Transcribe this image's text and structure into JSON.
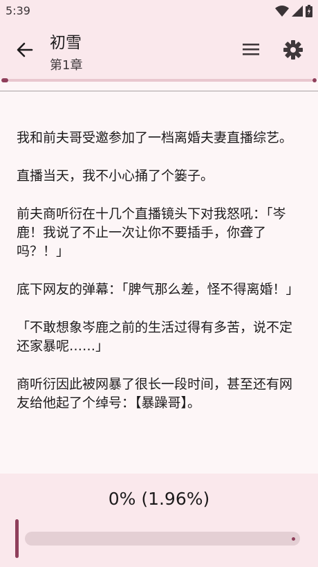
{
  "status_bar": {
    "time": "5:39",
    "icons": [
      "wifi-icon",
      "signal-icon",
      "battery-icon"
    ]
  },
  "app_bar": {
    "title": "初雪",
    "subtitle": "第1章",
    "icons": [
      "back-arrow-icon",
      "menu-icon",
      "gear-icon"
    ]
  },
  "content": {
    "paragraphs": [
      "我和前夫哥受邀参加了一档离婚夫妻直播综艺。",
      "直播当天，我不小心捅了个篓子。",
      "前夫商听衍在十几个直播镜头下对我怒吼：「岑鹿！我说了不止一次让你不要插手，你聋了吗？！」",
      "底下网友的弹幕：「脾气那么差，怪不得离婚！」",
      "「不敢想象岑鹿之前的生活过得有多苦，说不定还家暴呢……」",
      "商听衍因此被网暴了很长一段时间，甚至还有网友给他起了个绰号：【暴躁哥】。"
    ]
  },
  "progress": {
    "label": "0% (1.96%)",
    "value_fraction": 0.0
  },
  "colors": {
    "accent": "#8f3f5b",
    "panel": "#fae8ec",
    "background": "#fdf6f7"
  }
}
